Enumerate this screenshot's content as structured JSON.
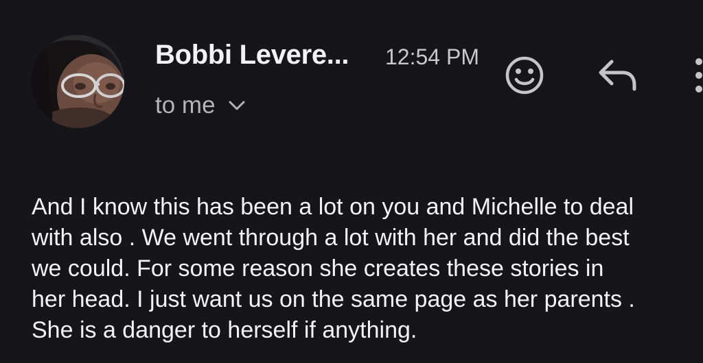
{
  "header": {
    "sender_name": "Bobbi Levere...",
    "timestamp": "12:54 PM",
    "recipient_label": "to me",
    "avatar_icon": "sender-photo",
    "actions": [
      {
        "icon": "emoji-reaction-icon"
      },
      {
        "icon": "reply-icon"
      },
      {
        "icon": "more-vert-icon"
      }
    ]
  },
  "message": {
    "lines": [
      "And I know this has been a lot on you and Michelle to deal",
      "with also . We went through a lot with her and did the best",
      "we could. For some reason she creates these stories in",
      "her head. I just want us on the same page as her parents .",
      "She is a danger to herself if anything."
    ]
  },
  "colors": {
    "background": "#16161a",
    "text_primary": "#f4f4f6",
    "text_secondary": "#b4b4b9",
    "icon": "#c4c4c9"
  }
}
